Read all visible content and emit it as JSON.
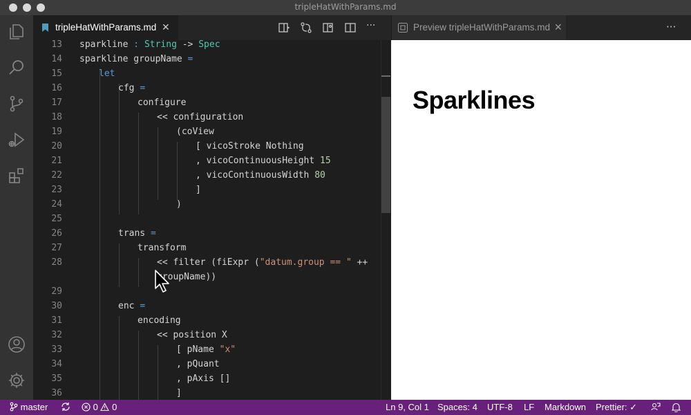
{
  "window": {
    "title": "tripleHatWithParams.md"
  },
  "activity_bar": {
    "items": [
      "explorer-icon",
      "search-icon",
      "source-control-icon",
      "run-debug-icon",
      "extensions-icon"
    ],
    "bottom": [
      "account-icon",
      "settings-gear-icon"
    ]
  },
  "editor": {
    "tab_label": "tripleHatWithParams.md",
    "tab_close": "✕",
    "actions": [
      "open-changes-icon",
      "go-to-file-icon",
      "open-preview-icon",
      "split-editor-icon",
      "more-actions-icon"
    ],
    "more_glyph": "···",
    "lines": [
      {
        "n": "13",
        "text": "sparkline : String -> Spec"
      },
      {
        "n": "14",
        "text": "sparkline groupName ="
      },
      {
        "n": "15",
        "text": "let"
      },
      {
        "n": "16",
        "text": "cfg ="
      },
      {
        "n": "17",
        "text": "configure"
      },
      {
        "n": "18",
        "text": "<< configuration"
      },
      {
        "n": "19",
        "text": "(coView"
      },
      {
        "n": "20",
        "text": "[ vicoStroke Nothing"
      },
      {
        "n": "21",
        "text": ", vicoContinuousHeight 15"
      },
      {
        "n": "22",
        "text": ", vicoContinuousWidth 80"
      },
      {
        "n": "23",
        "text": "]"
      },
      {
        "n": "24",
        "text": ")"
      },
      {
        "n": "25",
        "text": ""
      },
      {
        "n": "26",
        "text": "trans ="
      },
      {
        "n": "27",
        "text": "transform"
      },
      {
        "n": "28",
        "text": "<< filter (fiExpr (\"datum.group == \" ++"
      },
      {
        "n": "",
        "text": "groupName))"
      },
      {
        "n": "29",
        "text": ""
      },
      {
        "n": "30",
        "text": "enc ="
      },
      {
        "n": "31",
        "text": "encoding"
      },
      {
        "n": "32",
        "text": "<< position X"
      },
      {
        "n": "33",
        "text": "[ pName \"x\""
      },
      {
        "n": "34",
        "text": ", pQuant"
      },
      {
        "n": "35",
        "text": ", pAxis []"
      },
      {
        "n": "36",
        "text": "]"
      }
    ]
  },
  "preview": {
    "tab_label": "Preview tripleHatWithParams.md",
    "tab_close": "✕",
    "more_glyph": "···",
    "heading": "Sparklines"
  },
  "status_bar": {
    "branch": "master",
    "errors": "0",
    "warnings": "0",
    "position": "Ln 9, Col 1",
    "spaces": "Spaces: 4",
    "encoding": "UTF-8",
    "eol": "LF",
    "language": "Markdown",
    "prettier": "Prettier: ✓",
    "accent_color": "#68217a"
  }
}
